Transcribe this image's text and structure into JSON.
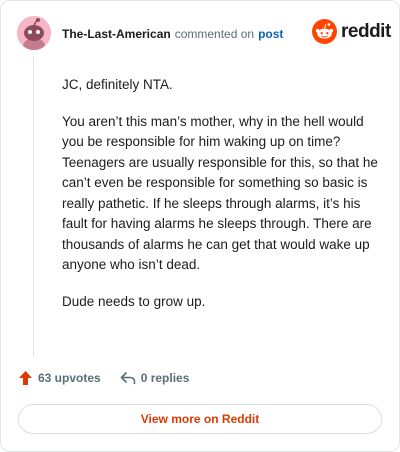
{
  "header": {
    "username": "The-Last-American",
    "commented_text": "commented on",
    "post_link": "post"
  },
  "logo": {
    "wordmark": "reddit",
    "icon": "reddit-snoo-icon",
    "brand_color": "#ff4500"
  },
  "comment": {
    "paragraphs": [
      "JC, definitely NTA.",
      "You aren’t this man’s mother, why in the hell would you be responsible for him waking up on time? Teenagers are usually responsible for this, so that he can’t even be responsible for something so basic is really pathetic. If he sleeps through alarms, it’s his fault for having alarms he sleeps through. There are thousands of alarms he can get that would wake up anyone who isn’t dead.",
      "Dude needs to grow up."
    ]
  },
  "actions": {
    "upvotes": "63 upvotes",
    "upvote_icon": "upvote-arrow-icon",
    "replies": "0 replies",
    "reply_icon": "reply-arrow-icon"
  },
  "footer": {
    "view_more": "View more on Reddit",
    "accent": "#d93a00"
  }
}
